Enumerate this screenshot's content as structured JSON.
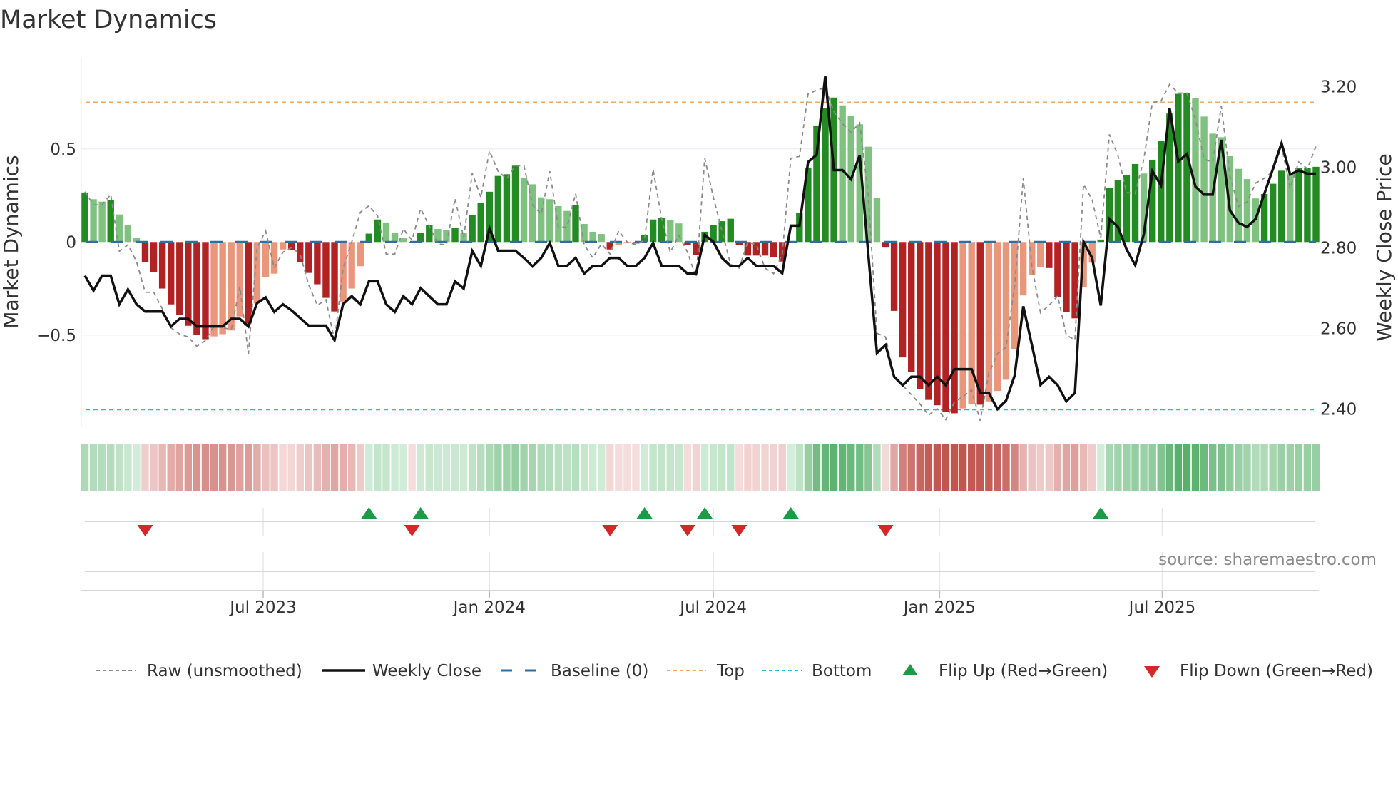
{
  "chart_data": {
    "type": "bar",
    "title": "Market Dynamics",
    "start_week": "2023-02-06",
    "frequency": "weekly",
    "left_axis": {
      "label": "Market Dynamics",
      "ylim": [
        -0.99,
        1.0
      ],
      "ticks": [
        {
          "value": 0.5,
          "label": "0.5"
        },
        {
          "value": 0,
          "label": "0"
        },
        {
          "value": -0.5,
          "label": "−0.5"
        }
      ]
    },
    "right_axis": {
      "label": "Weekly Close Price",
      "ticks": [
        {
          "value": 3.2,
          "label": "3.20"
        },
        {
          "value": 3.0,
          "label": "3.00"
        },
        {
          "value": 2.8,
          "label": "2.80"
        },
        {
          "value": 2.6,
          "label": "2.60"
        },
        {
          "value": 2.4,
          "label": "2.40"
        }
      ]
    },
    "x_ticks": [
      {
        "date": "2023-07-01",
        "label": "Jul 2023"
      },
      {
        "date": "2024-01-01",
        "label": "Jan 2024"
      },
      {
        "date": "2024-07-01",
        "label": "Jul 2024"
      },
      {
        "date": "2025-01-01",
        "label": "Jan 2025"
      },
      {
        "date": "2025-07-01",
        "label": "Jul 2025"
      }
    ],
    "reference_lines": {
      "baseline": 0,
      "top": 0.75,
      "bottom": -0.9
    },
    "series": [
      {
        "name": "Market Dynamics (smoothed)",
        "kind": "bar",
        "values": [
          0.266,
          0.23,
          0.217,
          0.227,
          0.148,
          0.093,
          0.02,
          -0.107,
          -0.16,
          -0.25,
          -0.335,
          -0.39,
          -0.45,
          -0.497,
          -0.522,
          -0.507,
          -0.495,
          -0.475,
          -0.4,
          -0.437,
          -0.33,
          -0.19,
          -0.17,
          -0.04,
          -0.045,
          -0.11,
          -0.166,
          -0.227,
          -0.3,
          -0.373,
          -0.32,
          -0.25,
          -0.13,
          0.045,
          0.121,
          0.105,
          0.05,
          0.02,
          -0.005,
          0.05,
          0.092,
          0.07,
          0.064,
          0.077,
          0.05,
          0.146,
          0.208,
          0.27,
          0.355,
          0.364,
          0.41,
          0.346,
          0.31,
          0.24,
          0.23,
          0.193,
          0.167,
          0.2,
          0.097,
          0.055,
          0.043,
          -0.04,
          -0.015,
          -0.005,
          -0.008,
          0.038,
          0.121,
          0.128,
          0.117,
          0.1,
          -0.015,
          -0.07,
          0.055,
          0.093,
          0.112,
          0.125,
          -0.018,
          -0.073,
          -0.073,
          -0.073,
          -0.082,
          -0.105,
          0.005,
          0.157,
          0.4,
          0.626,
          0.72,
          0.776,
          0.734,
          0.678,
          0.632,
          0.512,
          0.236,
          -0.03,
          -0.37,
          -0.62,
          -0.7,
          -0.788,
          -0.848,
          -0.877,
          -0.912,
          -0.92,
          -0.894,
          -0.871,
          -0.874,
          -0.856,
          -0.8,
          -0.74,
          -0.577,
          -0.287,
          -0.178,
          -0.133,
          -0.14,
          -0.296,
          -0.377,
          -0.41,
          -0.243,
          -0.111,
          0.013,
          0.29,
          0.333,
          0.361,
          0.419,
          0.368,
          0.442,
          0.544,
          0.69,
          0.796,
          0.8,
          0.773,
          0.674,
          0.582,
          0.563,
          0.461,
          0.393,
          0.338,
          0.234,
          0.258,
          0.313,
          0.383,
          0.368,
          0.398,
          0.398,
          0.404
        ]
      },
      {
        "name": "Raw (unsmoothed)",
        "kind": "line",
        "values": [
          0.27,
          0.2,
          0.2,
          0.255,
          -0.05,
          -0.015,
          -0.105,
          -0.27,
          -0.27,
          -0.36,
          -0.46,
          -0.495,
          -0.51,
          -0.56,
          -0.53,
          -0.45,
          -0.46,
          -0.47,
          -0.24,
          -0.6,
          -0.03,
          0.06,
          -0.14,
          -0.055,
          -0.03,
          -0.065,
          -0.23,
          -0.34,
          -0.31,
          -0.53,
          -0.14,
          0,
          0.16,
          0.195,
          0.14,
          -0.065,
          -0.065,
          0.07,
          0.01,
          0.18,
          0.087,
          -0.01,
          -0.015,
          0.235,
          0.023,
          0.37,
          0.24,
          0.49,
          0.38,
          0.34,
          0.41,
          0.41,
          0.2,
          0.15,
          0.38,
          0.08,
          0.08,
          0.26,
          -0.015,
          -0.085,
          -0.01,
          -0.065,
          0.06,
          0,
          -0.015,
          0.01,
          0.39,
          0.125,
          -0.055,
          0.035,
          -0.055,
          -0.19,
          0.45,
          0.24,
          0.06,
          -0.12,
          -0.14,
          0,
          -0.015,
          -0.14,
          -0.17,
          -0.065,
          0.45,
          0.46,
          0.795,
          0.815,
          0.83,
          0.7,
          0.636,
          0.59,
          0.64,
          0.25,
          -0.49,
          -0.51,
          -0.72,
          -0.77,
          -0.82,
          -0.87,
          -0.93,
          -0.896,
          -0.954,
          -0.86,
          -0.83,
          -0.795,
          -0.96,
          -0.705,
          -0.6,
          -0.565,
          -0.232,
          0.342,
          -0.13,
          -0.38,
          -0.34,
          -0.29,
          -0.5,
          -0.526,
          0.31,
          0.227,
          0.023,
          0.578,
          0.464,
          0.266,
          0.26,
          0.444,
          0.75,
          0.757,
          0.847,
          0.8,
          0.8,
          0.66,
          0.444,
          0.43,
          0.73,
          0.355,
          0.19,
          0.215,
          0.317,
          0.342,
          0.38,
          0.515,
          0.29,
          0.43,
          0.393,
          0.515
        ]
      },
      {
        "name": "Weekly Close",
        "kind": "line",
        "axis": "right",
        "values": [
          2.731,
          2.694,
          2.731,
          2.731,
          2.66,
          2.697,
          2.66,
          2.642,
          2.642,
          2.642,
          2.605,
          2.624,
          2.624,
          2.605,
          2.605,
          2.605,
          2.605,
          2.624,
          2.624,
          2.605,
          2.663,
          2.677,
          2.641,
          2.66,
          2.645,
          2.626,
          2.607,
          2.607,
          2.607,
          2.571,
          2.661,
          2.68,
          2.66,
          2.717,
          2.717,
          2.66,
          2.641,
          2.68,
          2.66,
          2.7,
          2.68,
          2.66,
          2.66,
          2.717,
          2.699,
          2.792,
          2.755,
          2.849,
          2.793,
          2.793,
          2.793,
          2.775,
          2.754,
          2.775,
          2.812,
          2.755,
          2.755,
          2.775,
          2.736,
          2.755,
          2.755,
          2.775,
          2.775,
          2.755,
          2.755,
          2.775,
          2.812,
          2.755,
          2.755,
          2.755,
          2.736,
          2.736,
          2.832,
          2.815,
          2.775,
          2.755,
          2.755,
          2.775,
          2.755,
          2.755,
          2.755,
          2.737,
          2.855,
          2.855,
          3.013,
          3.031,
          3.226,
          2.993,
          2.993,
          2.97,
          3.03,
          2.784,
          2.539,
          2.559,
          2.48,
          2.459,
          2.48,
          2.48,
          2.459,
          2.48,
          2.459,
          2.499,
          2.499,
          2.499,
          2.44,
          2.44,
          2.4,
          2.421,
          2.483,
          2.655,
          2.559,
          2.46,
          2.48,
          2.459,
          2.419,
          2.44,
          2.815,
          2.775,
          2.657,
          2.872,
          2.852,
          2.796,
          2.757,
          2.834,
          2.99,
          2.955,
          3.146,
          3.014,
          3.033,
          2.952,
          2.932,
          2.932,
          3.068,
          2.893,
          2.862,
          2.852,
          2.872,
          2.934,
          2.996,
          3.06,
          2.982,
          2.992,
          2.984,
          2.984
        ]
      }
    ],
    "flip_up_dates": [
      "2023-09-25",
      "2023-11-06",
      "2024-05-06",
      "2024-06-24",
      "2024-09-02",
      "2025-05-12"
    ],
    "flip_down_dates": [
      "2023-03-27",
      "2023-10-30",
      "2024-04-08",
      "2024-06-10",
      "2024-07-22",
      "2024-11-18"
    ],
    "legend": {
      "position": "bottom",
      "items": [
        {
          "label": "Raw (unsmoothed)"
        },
        {
          "label": "Weekly Close"
        },
        {
          "label": "Baseline (0)"
        },
        {
          "label": "Top"
        },
        {
          "label": "Bottom"
        },
        {
          "label": "Flip Up (Red→Green)"
        },
        {
          "label": "Flip Down (Green→Red)"
        }
      ]
    },
    "source": "source: sharemaestro.com",
    "colors": {
      "pos_rising": "#228b22",
      "pos_falling": "#7fc27f",
      "neg_falling": "#b22222",
      "neg_rising": "#e9967a",
      "raw": "#8a8a8a",
      "close": "#111111",
      "baseline": "#2e6fa3",
      "top": "#f0a868",
      "bottom": "#1fbfd4",
      "flip_up": "#1a9b45",
      "flip_down": "#d62728"
    }
  }
}
